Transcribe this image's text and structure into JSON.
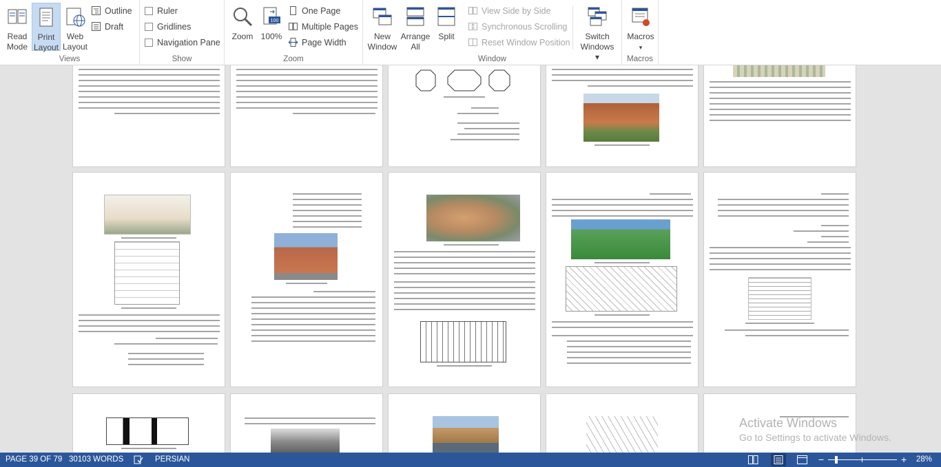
{
  "ribbon": {
    "views": {
      "label": "Views",
      "read_mode": "Read\nMode",
      "print_layout": "Print\nLayout",
      "web_layout": "Web\nLayout",
      "outline": "Outline",
      "draft": "Draft"
    },
    "show": {
      "label": "Show",
      "ruler": "Ruler",
      "gridlines": "Gridlines",
      "navigation_pane": "Navigation Pane"
    },
    "zoom": {
      "label": "Zoom",
      "zoom": "Zoom",
      "hundred": "100%",
      "one_page": "One Page",
      "multiple_pages": "Multiple Pages",
      "page_width": "Page Width"
    },
    "window": {
      "label": "Window",
      "new_window": "New\nWindow",
      "arrange_all": "Arrange\nAll",
      "split": "Split",
      "view_side_by_side": "View Side by Side",
      "synchronous_scrolling": "Synchronous Scrolling",
      "reset_window_position": "Reset Window Position",
      "switch_windows": "Switch\nWindows ▾"
    },
    "macros": {
      "label": "Macros",
      "macros": "Macros",
      "dropdown": "▾"
    }
  },
  "status": {
    "page": "PAGE 39 OF 79",
    "words": "30103 WORDS",
    "language": "PERSIAN",
    "zoom": "28%"
  },
  "watermark": {
    "line1": "Activate Windows",
    "line2": "Go to Settings to activate Windows."
  },
  "colors": {
    "accent": "#2b579a",
    "active_button": "#c5dbf2",
    "workspace": "#e3e3e3"
  }
}
